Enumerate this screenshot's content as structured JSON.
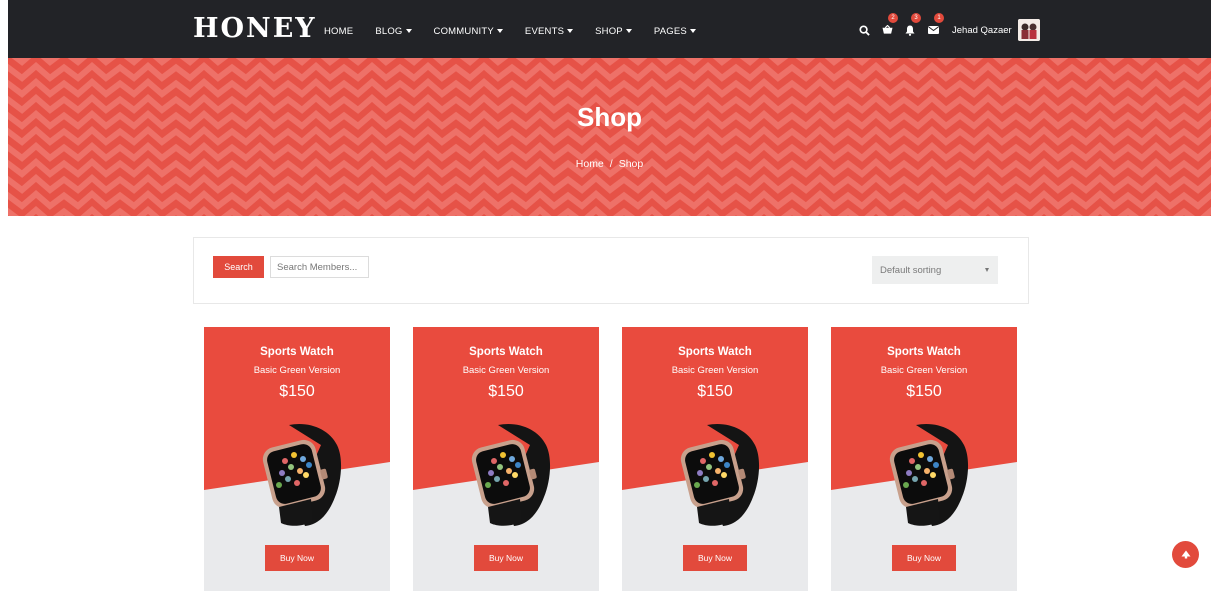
{
  "brand": {
    "logo": "HONEY"
  },
  "nav": {
    "items": [
      {
        "label": "HOME",
        "has_dropdown": false
      },
      {
        "label": "BLOG",
        "has_dropdown": true
      },
      {
        "label": "COMMUNITY",
        "has_dropdown": true
      },
      {
        "label": "EVENTS",
        "has_dropdown": true
      },
      {
        "label": "SHOP",
        "has_dropdown": true
      },
      {
        "label": "PAGES",
        "has_dropdown": true
      }
    ],
    "icons": {
      "search": "search-icon",
      "cart": "cart-icon",
      "cart_count": "2",
      "notifications": "bell-icon",
      "notifications_count": "3",
      "messages": "envelope-icon",
      "messages_count": "1"
    },
    "user": {
      "name": "Jehad Qazaer",
      "avatar": "avatar-photo"
    }
  },
  "hero": {
    "title": "Shop",
    "breadcrumb": {
      "home": "Home",
      "separator": "/",
      "current": "Shop"
    }
  },
  "filter": {
    "search_button": "Search",
    "search_placeholder": "Search Members...",
    "sort_selected": "Default sorting"
  },
  "products": [
    {
      "name": "Sports Watch",
      "subtitle": "Basic Green Version",
      "price": "$150",
      "button": "Buy Now"
    },
    {
      "name": "Sports Watch",
      "subtitle": "Basic Green Version",
      "price": "$150",
      "button": "Buy Now"
    },
    {
      "name": "Sports Watch",
      "subtitle": "Basic Green Version",
      "price": "$150",
      "button": "Buy Now"
    },
    {
      "name": "Sports Watch",
      "subtitle": "Basic Green Version",
      "price": "$150",
      "button": "Buy Now"
    }
  ],
  "colors": {
    "accent": "#e24a3c",
    "nav_bg": "#222327",
    "hero_bg": "#e65247",
    "card_bg": "#e94b3e",
    "card_bottom": "#e9eaec"
  },
  "scroll_top_icon": "arrow-up-icon"
}
